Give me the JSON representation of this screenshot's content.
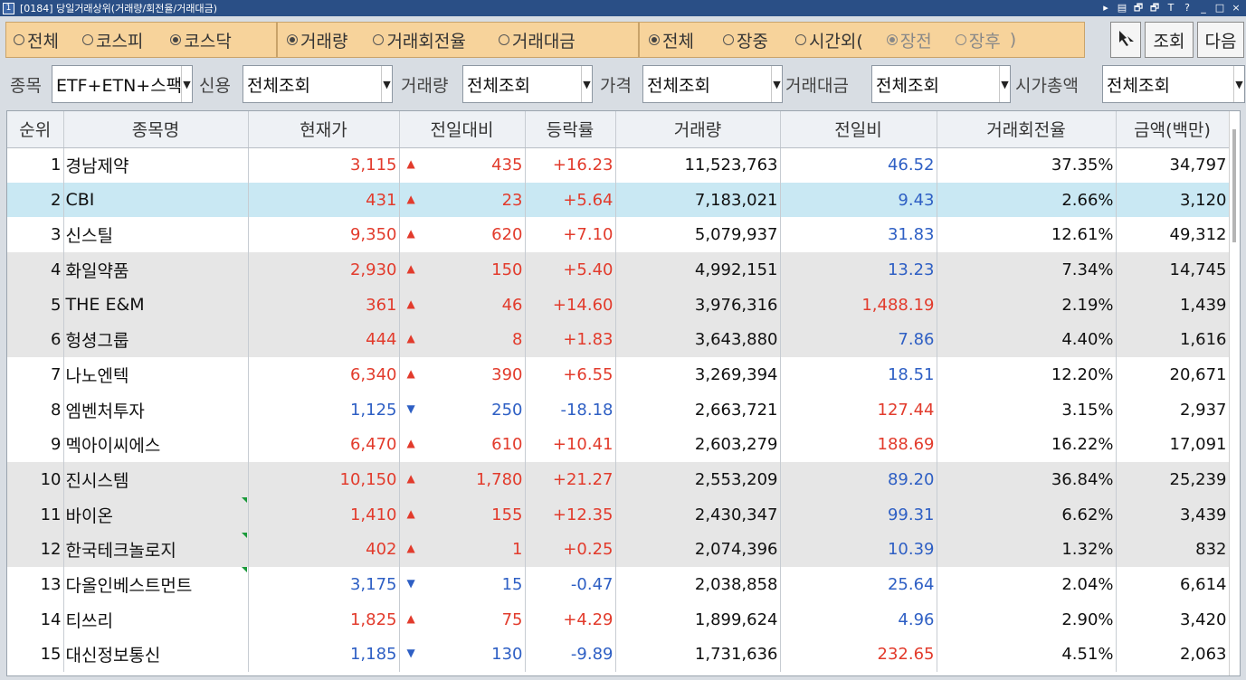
{
  "window": {
    "icon": "1",
    "title": "[0184] 당일거래상위(거래량/회전율/거래대금)"
  },
  "titlebar_controls": [
    "▸",
    "▤",
    "🗗",
    "🗗",
    "T",
    "?",
    "_",
    "□",
    "×"
  ],
  "market_filter": [
    {
      "label": "전체",
      "selected": false
    },
    {
      "label": "코스피",
      "selected": false
    },
    {
      "label": "코스닥",
      "selected": true
    }
  ],
  "sort_filter": [
    {
      "label": "거래량",
      "selected": true
    },
    {
      "label": "거래회전율",
      "selected": false
    },
    {
      "label": "거래대금",
      "selected": false
    }
  ],
  "session_filter": {
    "all": {
      "label": "전체",
      "selected": true
    },
    "regular": {
      "label": "장중",
      "selected": false
    },
    "afterhours_prefix": "시간외(",
    "pre": {
      "label": "장전",
      "selected": true
    },
    "post": {
      "label": "장후",
      "selected": false
    },
    "suffix": ")"
  },
  "buttons": {
    "query": "조회",
    "next": "다음"
  },
  "filters": {
    "item": {
      "label": "종목",
      "value": "ETF+ETN+스팩 제외"
    },
    "credit": {
      "label": "신용",
      "value": "전체조회"
    },
    "volume": {
      "label": "거래량",
      "value": "전체조회"
    },
    "price": {
      "label": "가격",
      "value": "전체조회"
    },
    "amount": {
      "label": "거래대금",
      "value": "전체조회"
    },
    "marketcap": {
      "label": "시가총액",
      "value": "전체조회"
    }
  },
  "table": {
    "headers": [
      "순위",
      "종목명",
      "현재가",
      "전일대비",
      "등락률",
      "거래량",
      "전일비",
      "거래회전율",
      "금액(백만)"
    ],
    "rows": [
      {
        "rank": "1",
        "name": "경남제약",
        "price": "3,115",
        "dir": "up",
        "change": "435",
        "rate": "+16.23",
        "volume": "11,523,763",
        "prev_ratio": "46.52",
        "prev_dir": "down",
        "turnover": "37.35%",
        "amount": "34,797"
      },
      {
        "rank": "2",
        "name": "CBI",
        "price": "431",
        "dir": "up",
        "change": "23",
        "rate": "+5.64",
        "volume": "7,183,021",
        "prev_ratio": "9.43",
        "prev_dir": "down",
        "turnover": "2.66%",
        "amount": "3,120"
      },
      {
        "rank": "3",
        "name": "신스틸",
        "price": "9,350",
        "dir": "up",
        "change": "620",
        "rate": "+7.10",
        "volume": "5,079,937",
        "prev_ratio": "31.83",
        "prev_dir": "down",
        "turnover": "12.61%",
        "amount": "49,312"
      },
      {
        "rank": "4",
        "name": "화일약품",
        "price": "2,930",
        "dir": "up",
        "change": "150",
        "rate": "+5.40",
        "volume": "4,992,151",
        "prev_ratio": "13.23",
        "prev_dir": "down",
        "turnover": "7.34%",
        "amount": "14,745"
      },
      {
        "rank": "5",
        "name": "THE E&M",
        "price": "361",
        "dir": "up",
        "change": "46",
        "rate": "+14.60",
        "volume": "3,976,316",
        "prev_ratio": "1,488.19",
        "prev_dir": "up",
        "turnover": "2.19%",
        "amount": "1,439"
      },
      {
        "rank": "6",
        "name": "헝셩그룹",
        "price": "444",
        "dir": "up",
        "change": "8",
        "rate": "+1.83",
        "volume": "3,643,880",
        "prev_ratio": "7.86",
        "prev_dir": "down",
        "turnover": "4.40%",
        "amount": "1,616"
      },
      {
        "rank": "7",
        "name": "나노엔텍",
        "price": "6,340",
        "dir": "up",
        "change": "390",
        "rate": "+6.55",
        "volume": "3,269,394",
        "prev_ratio": "18.51",
        "prev_dir": "down",
        "turnover": "12.20%",
        "amount": "20,671"
      },
      {
        "rank": "8",
        "name": "엠벤처투자",
        "price": "1,125",
        "dir": "down",
        "change": "250",
        "rate": "-18.18",
        "volume": "2,663,721",
        "prev_ratio": "127.44",
        "prev_dir": "up",
        "turnover": "3.15%",
        "amount": "2,937"
      },
      {
        "rank": "9",
        "name": "멕아이씨에스",
        "price": "6,470",
        "dir": "up",
        "change": "610",
        "rate": "+10.41",
        "volume": "2,603,279",
        "prev_ratio": "188.69",
        "prev_dir": "up",
        "turnover": "16.22%",
        "amount": "17,091"
      },
      {
        "rank": "10",
        "name": "진시스템",
        "price": "10,150",
        "dir": "up",
        "change": "1,780",
        "rate": "+21.27",
        "volume": "2,553,209",
        "prev_ratio": "89.20",
        "prev_dir": "down",
        "turnover": "36.84%",
        "amount": "25,239"
      },
      {
        "rank": "11",
        "name": "바이온",
        "price": "1,410",
        "dir": "up",
        "change": "155",
        "rate": "+12.35",
        "volume": "2,430,347",
        "prev_ratio": "99.31",
        "prev_dir": "down",
        "turnover": "6.62%",
        "amount": "3,439"
      },
      {
        "rank": "12",
        "name": "한국테크놀로지",
        "price": "402",
        "dir": "up",
        "change": "1",
        "rate": "+0.25",
        "volume": "2,074,396",
        "prev_ratio": "10.39",
        "prev_dir": "down",
        "turnover": "1.32%",
        "amount": "832"
      },
      {
        "rank": "13",
        "name": "다올인베스트먼트",
        "price": "3,175",
        "dir": "down",
        "change": "15",
        "rate": "-0.47",
        "volume": "2,038,858",
        "prev_ratio": "25.64",
        "prev_dir": "down",
        "turnover": "2.04%",
        "amount": "6,614"
      },
      {
        "rank": "14",
        "name": "티쓰리",
        "price": "1,825",
        "dir": "up",
        "change": "75",
        "rate": "+4.29",
        "volume": "1,899,624",
        "prev_ratio": "4.96",
        "prev_dir": "down",
        "turnover": "2.90%",
        "amount": "3,420"
      },
      {
        "rank": "15",
        "name": "대신정보통신",
        "price": "1,185",
        "dir": "down",
        "change": "130",
        "rate": "-9.89",
        "volume": "1,731,636",
        "prev_ratio": "232.65",
        "prev_dir": "up",
        "turnover": "4.51%",
        "amount": "2,063"
      }
    ]
  },
  "colors": {
    "up": "#e23b2c",
    "down": "#2e5fc4",
    "selected_row": "#c9e8f3",
    "gray_row": "#e6e6e6",
    "filter_bg": "#f7d39b"
  }
}
